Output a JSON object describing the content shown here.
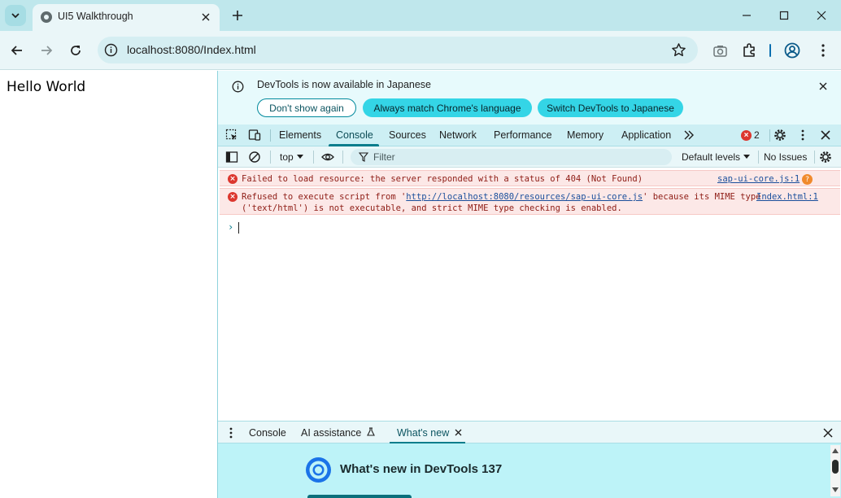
{
  "browser": {
    "tab_title": "UI5 Walkthrough",
    "url": "localhost:8080/Index.html"
  },
  "page": {
    "heading": "Hello World"
  },
  "devtools": {
    "infobar": {
      "message": "DevTools is now available in Japanese",
      "btn_dont_show": "Don't show again",
      "btn_match_language": "Always match Chrome's language",
      "btn_switch": "Switch DevTools to Japanese"
    },
    "tabs": [
      "Elements",
      "Console",
      "Sources",
      "Network",
      "Performance",
      "Memory",
      "Application"
    ],
    "active_tab": "Console",
    "error_count": "2",
    "console_toolbar": {
      "context": "top",
      "filter_placeholder": "Filter",
      "levels": "Default levels",
      "issues": "No Issues"
    },
    "messages": [
      {
        "text": "Failed to load resource: the server responded with a status of 404 (Not Found)",
        "source": "sap-ui-core.js:1"
      },
      {
        "text_before": "Refused to execute script from '",
        "link": "http://localhost:8080/resources/sap-ui-core.js",
        "text_after": "' because its MIME type",
        "text_line2": "('text/html') is not executable, and strict MIME type checking is enabled.",
        "source": "Index.html:1"
      }
    ],
    "drawer": {
      "tabs": [
        "Console",
        "AI assistance",
        "What's new"
      ],
      "active_tab": "What's new",
      "whats_new_title": "What's new in DevTools 137"
    }
  },
  "colors": {
    "chrome_accent": "#bfe7ec",
    "active_tab_accent": "#0a7d8c",
    "error_red": "#dc362e",
    "error_bg": "#fce8e7"
  }
}
